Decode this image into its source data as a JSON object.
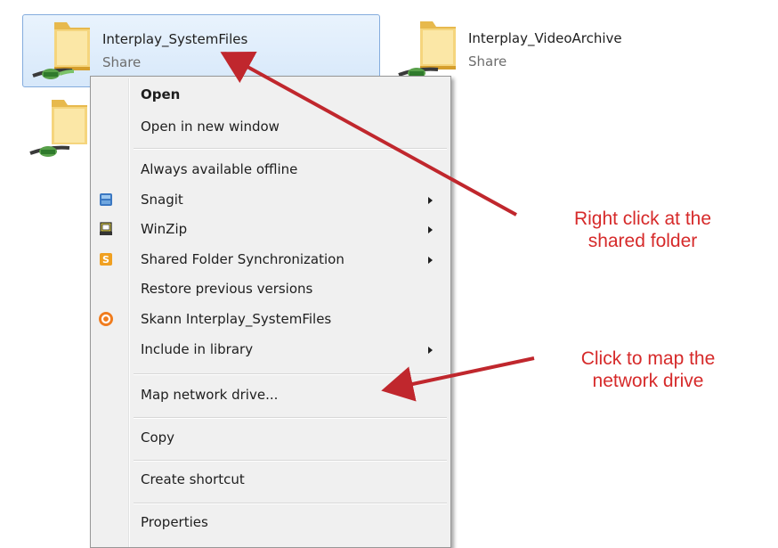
{
  "shares": [
    {
      "name": "Interplay_SystemFiles",
      "subtitle": "Share"
    },
    {
      "name": "Interplay_VideoArchive",
      "subtitle": "Share"
    }
  ],
  "context_menu": {
    "items": [
      {
        "label": "Open"
      },
      {
        "label": "Open in new window"
      },
      {
        "label": "Always available offline"
      },
      {
        "label": "Snagit",
        "icon": "snagit-icon"
      },
      {
        "label": "WinZip",
        "icon": "winzip-icon"
      },
      {
        "label": "Shared Folder Synchronization",
        "icon": "sync-icon"
      },
      {
        "label": "Restore previous versions"
      },
      {
        "label": "Skann Interplay_SystemFiles",
        "icon": "skann-icon"
      },
      {
        "label": "Include in library"
      },
      {
        "label": "Map network drive..."
      },
      {
        "label": "Copy"
      },
      {
        "label": "Create shortcut"
      },
      {
        "label": "Properties"
      }
    ]
  },
  "annotations": {
    "right_click": "Right click at the shared folder",
    "right_click_line1": "Right click at the",
    "right_click_line2": "shared folder",
    "map_drive_line1": "Click to map the",
    "map_drive_line2": "network drive"
  },
  "colors": {
    "annotation": "#d62a2a",
    "selection": "#d7e8fa",
    "menu_background": "#f0f0f0"
  }
}
